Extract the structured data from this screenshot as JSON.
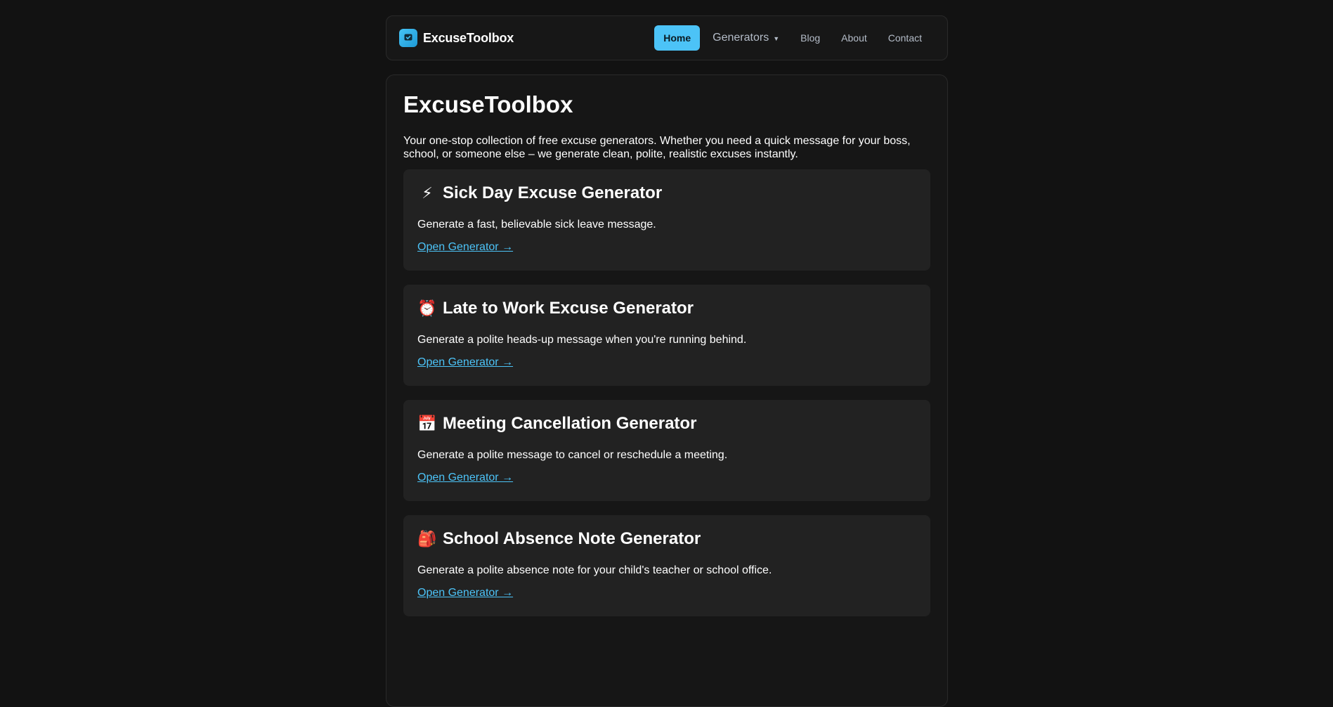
{
  "header": {
    "brand": "ExcuseToolbox",
    "nav": [
      {
        "label": "Home",
        "active": true
      },
      {
        "label": "Generators",
        "dropdown": true
      },
      {
        "label": "Blog"
      },
      {
        "label": "About"
      },
      {
        "label": "Contact"
      }
    ]
  },
  "main": {
    "title": "ExcuseToolbox",
    "intro": "Your one-stop collection of free excuse generators. Whether you need a quick message for your boss, school, or someone else – we generate clean, polite, realistic excuses instantly.",
    "cards": [
      {
        "emoji": "⚡",
        "title": "Sick Day Excuse Generator",
        "description": "Generate a fast, believable sick leave message.",
        "link": "Open Generator →"
      },
      {
        "emoji": "⏰",
        "title": "Late to Work Excuse Generator",
        "description": "Generate a polite heads-up message when you're running behind.",
        "link": "Open Generator →"
      },
      {
        "emoji": "📅",
        "title": "Meeting Cancellation Generator",
        "description": "Generate a polite message to cancel or reschedule a meeting.",
        "link": "Open Generator →"
      },
      {
        "emoji": "🎒",
        "title": "School Absence Note Generator",
        "description": "Generate a polite absence note for your child's teacher or school office.",
        "link": "Open Generator →"
      }
    ]
  },
  "colors": {
    "background": "#121212",
    "accent": "#4cc3f7",
    "card": "#222222"
  },
  "icons": {
    "brand": "check-bubble-icon",
    "dropdown": "caret-down-icon"
  }
}
